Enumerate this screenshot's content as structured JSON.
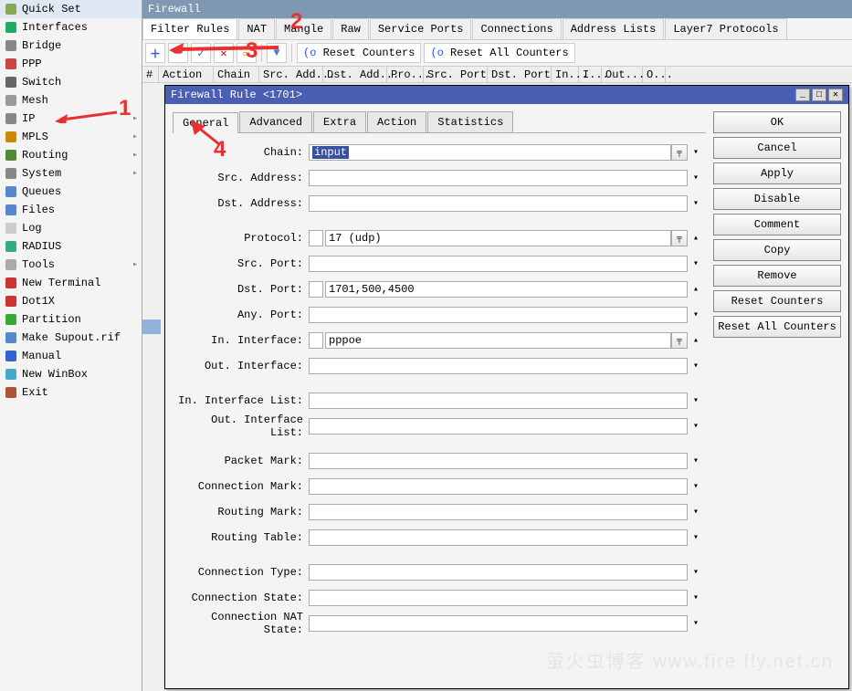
{
  "sidebar": [
    {
      "label": "Quick Set",
      "icon": "wand",
      "exp": ""
    },
    {
      "label": "Interfaces",
      "icon": "iface",
      "exp": ""
    },
    {
      "label": "Bridge",
      "icon": "bridge",
      "exp": ""
    },
    {
      "label": "PPP",
      "icon": "ppp",
      "exp": ""
    },
    {
      "label": "Switch",
      "icon": "switch",
      "exp": ""
    },
    {
      "label": "Mesh",
      "icon": "mesh",
      "exp": ""
    },
    {
      "label": "IP",
      "icon": "ip",
      "exp": "▸"
    },
    {
      "label": "MPLS",
      "icon": "mpls",
      "exp": "▸"
    },
    {
      "label": "Routing",
      "icon": "route",
      "exp": "▸"
    },
    {
      "label": "System",
      "icon": "gear",
      "exp": "▸"
    },
    {
      "label": "Queues",
      "icon": "queue",
      "exp": ""
    },
    {
      "label": "Files",
      "icon": "folder",
      "exp": ""
    },
    {
      "label": "Log",
      "icon": "log",
      "exp": ""
    },
    {
      "label": "RADIUS",
      "icon": "radius",
      "exp": ""
    },
    {
      "label": "Tools",
      "icon": "tools",
      "exp": "▸"
    },
    {
      "label": "New Terminal",
      "icon": "term",
      "exp": ""
    },
    {
      "label": "Dot1X",
      "icon": "dot1x",
      "exp": ""
    },
    {
      "label": "Partition",
      "icon": "part",
      "exp": ""
    },
    {
      "label": "Make Supout.rif",
      "icon": "supout",
      "exp": ""
    },
    {
      "label": "Manual",
      "icon": "manual",
      "exp": ""
    },
    {
      "label": "New WinBox",
      "icon": "winbox",
      "exp": ""
    },
    {
      "label": "Exit",
      "icon": "exit",
      "exp": ""
    }
  ],
  "main_title": "Firewall",
  "tabs": [
    "Filter Rules",
    "NAT",
    "Mangle",
    "Raw",
    "Service Ports",
    "Connections",
    "Address Lists",
    "Layer7 Protocols"
  ],
  "toolbar": {
    "reset": "Reset Counters",
    "reset_all": "Reset All Counters"
  },
  "grid_cols": [
    "#",
    "Action",
    "Chain",
    "Src. Add...",
    "Dst. Add...",
    "Pro...",
    "Src. Port",
    "Dst. Port",
    "In...",
    "I...",
    "Out...",
    "O..."
  ],
  "dialog": {
    "title": "Firewall Rule <1701>",
    "tabs": [
      "General",
      "Advanced",
      "Extra",
      "Action",
      "Statistics"
    ],
    "buttons": [
      "OK",
      "Cancel",
      "Apply",
      "Disable",
      "Comment",
      "Copy",
      "Remove",
      "Reset Counters",
      "Reset All Counters"
    ],
    "fields": {
      "chain_label": "Chain:",
      "chain_value": "input",
      "srcaddr_label": "Src. Address:",
      "srcaddr_value": "",
      "dstaddr_label": "Dst. Address:",
      "dstaddr_value": "",
      "proto_label": "Protocol:",
      "proto_value": "17 (udp)",
      "srcport_label": "Src. Port:",
      "srcport_value": "",
      "dstport_label": "Dst. Port:",
      "dstport_value": "1701,500,4500",
      "anyport_label": "Any. Port:",
      "anyport_value": "",
      "inif_label": "In. Interface:",
      "inif_value": "pppoe",
      "outif_label": "Out. Interface:",
      "outif_value": "",
      "iniflist_label": "In. Interface List:",
      "iniflist_value": "",
      "outiflist_label": "Out. Interface List:",
      "outiflist_value": "",
      "pktmark_label": "Packet Mark:",
      "pktmark_value": "",
      "connmark_label": "Connection Mark:",
      "connmark_value": "",
      "routemark_label": "Routing Mark:",
      "routemark_value": "",
      "routetbl_label": "Routing Table:",
      "routetbl_value": "",
      "conntype_label": "Connection Type:",
      "conntype_value": "",
      "connstate_label": "Connection State:",
      "connstate_value": "",
      "connnat_label": "Connection NAT State:",
      "connnat_value": ""
    }
  },
  "annotations": {
    "n1": "1",
    "n2": "2",
    "n3": "3",
    "n4": "4"
  },
  "watermark": "萤火虫博客 www.fire fly.net.cn"
}
